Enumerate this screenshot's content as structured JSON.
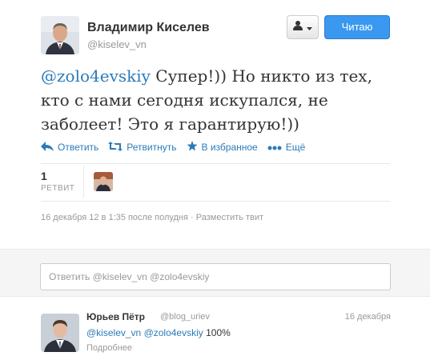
{
  "tweet": {
    "author_name": "Владимир Киселев",
    "author_handle": "@kiselev_vn",
    "follow_label": "Читаю",
    "mention": "@zolo4evskiy",
    "body": " Супер!)) Но никто из тех, кто с нами сегодня искупался, не заболеет! Это я гарантирую!))",
    "actions": {
      "reply": "Ответить",
      "retweet": "Ретвитнуть",
      "favorite": "В избранное",
      "more": "Ещё"
    },
    "stats": {
      "retweet_count": "1",
      "retweet_label": "РЕТВИТ"
    },
    "timestamp": "16 декабря 12 в 1:35 после полудня",
    "embed_link": "Разместить твит"
  },
  "reply_box": {
    "placeholder": "Ответить @kiselev_vn @zolo4evskiy"
  },
  "reply": {
    "author_name": "Юрьев Пётр",
    "author_handle": "@blog_uriev",
    "date": "16 декабря",
    "mention1": "@kiselev_vn",
    "mention2": "@zolo4evskiy",
    "text_suffix": " 100%",
    "more_label": "Подробнее"
  },
  "colors": {
    "link": "#2b7bb9",
    "button": "#3a98f0",
    "muted": "#999999"
  }
}
